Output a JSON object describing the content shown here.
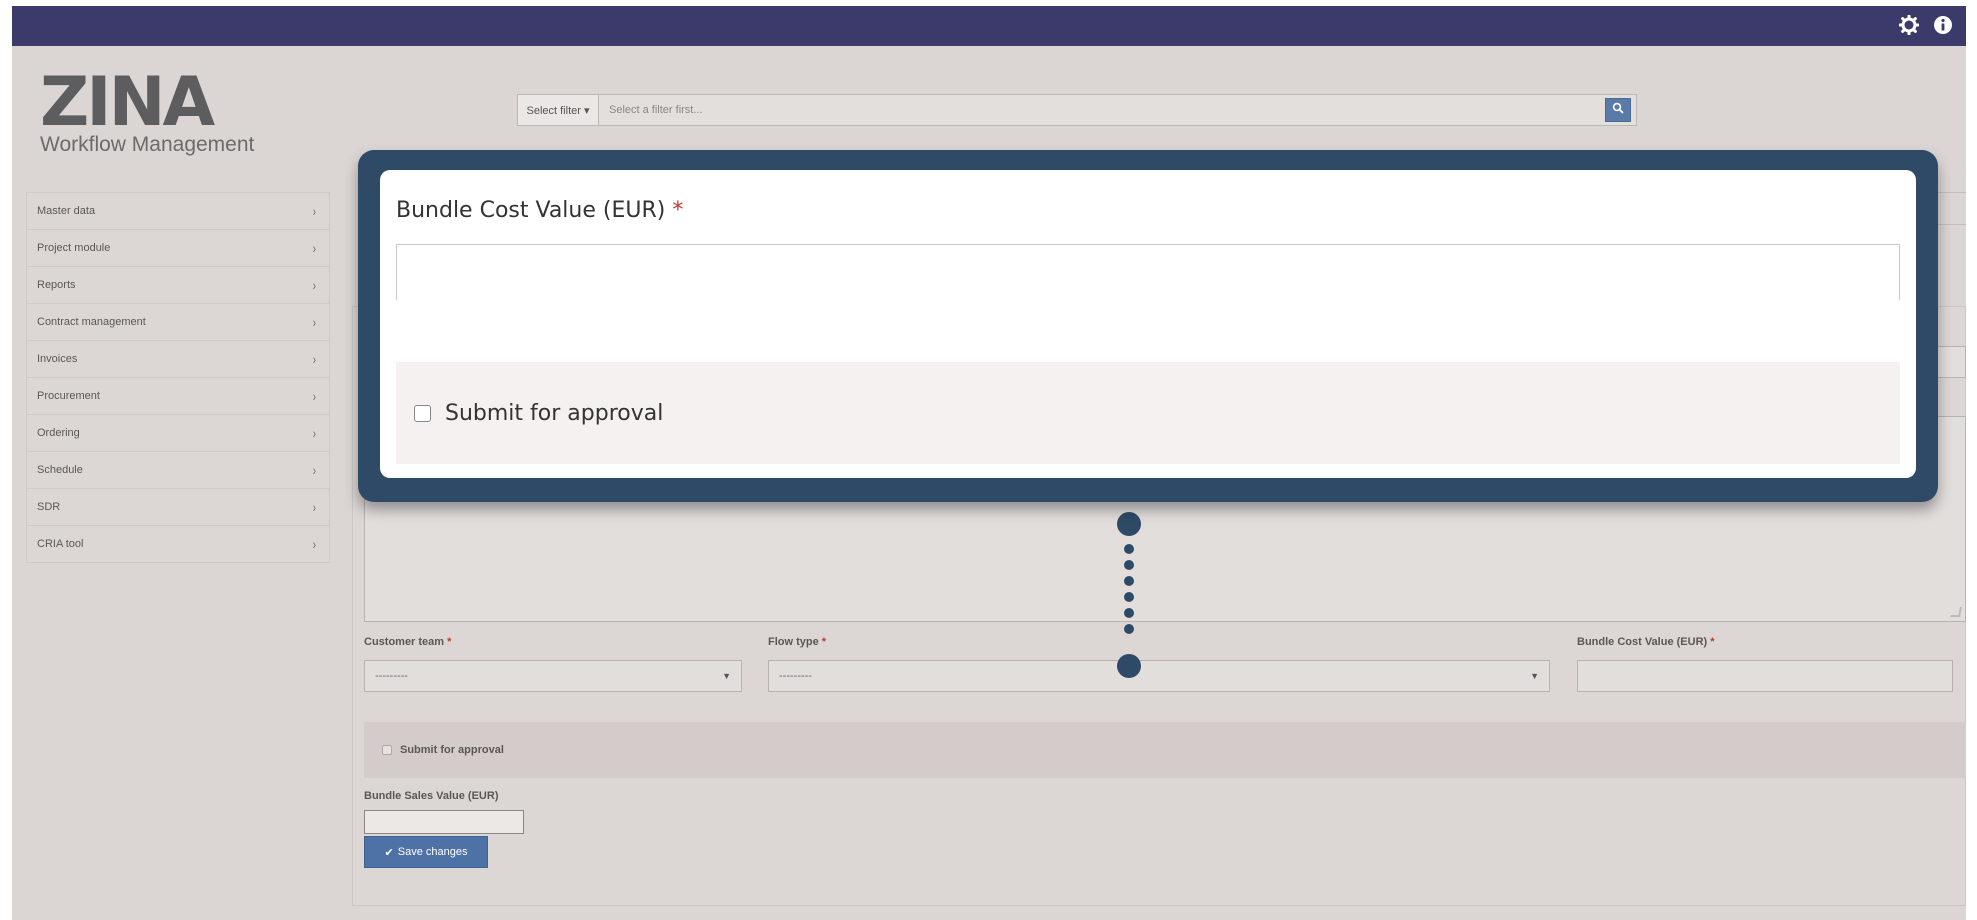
{
  "app": {
    "logo_main": "ZINA",
    "logo_sub": "Workflow Management"
  },
  "topbar": {
    "icons": [
      "gear-icon",
      "info-icon"
    ]
  },
  "filter": {
    "select_label": "Select filter ▾",
    "input_placeholder": "Select a filter first...",
    "search_icon": "search-icon"
  },
  "sidebar": {
    "items": [
      {
        "label": "Master data"
      },
      {
        "label": "Project module"
      },
      {
        "label": "Reports"
      },
      {
        "label": "Contract management"
      },
      {
        "label": "Invoices"
      },
      {
        "label": "Procurement"
      },
      {
        "label": "Ordering"
      },
      {
        "label": "Schedule"
      },
      {
        "label": "SDR"
      },
      {
        "label": "CRIA tool"
      }
    ],
    "chevron": "›"
  },
  "form": {
    "customer_team_label": "Customer team",
    "customer_team_value": "---------",
    "flow_type_label": "Flow type",
    "flow_type_value": "---------",
    "bundle_cost_label": "Bundle Cost Value (EUR)",
    "submit_label": "Submit for approval",
    "bundle_sales_label": "Bundle Sales Value (EUR)",
    "save_label": "Save changes",
    "required_mark": "*"
  },
  "callout": {
    "bundle_cost_label": "Bundle Cost Value (EUR)",
    "required_mark": "*",
    "bundle_cost_value": "",
    "submit_label": "Submit for approval"
  },
  "colors": {
    "topbar": "#3b3a6a",
    "callout_frame": "#2f4a66",
    "accent_button": "#4f72a6",
    "required": "#c0392b"
  }
}
